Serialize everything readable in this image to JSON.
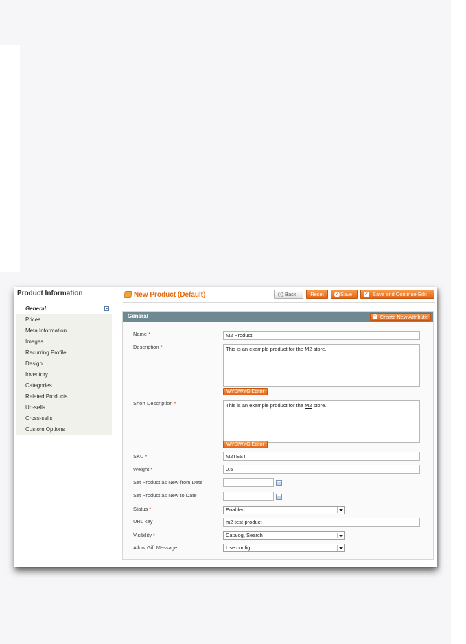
{
  "sidebar": {
    "title": "Product Information",
    "tabs": [
      {
        "label": "General"
      },
      {
        "label": "Prices"
      },
      {
        "label": "Meta Information"
      },
      {
        "label": "Images"
      },
      {
        "label": "Recurring Profile"
      },
      {
        "label": "Design"
      },
      {
        "label": "Inventory"
      },
      {
        "label": "Categories"
      },
      {
        "label": "Related Products"
      },
      {
        "label": "Up-sells"
      },
      {
        "label": "Cross-sells"
      },
      {
        "label": "Custom Options"
      }
    ]
  },
  "header": {
    "title": "New Product (Default)",
    "buttons": {
      "back": "Back",
      "reset": "Reset",
      "save": "Save",
      "save_continue": "Save and Continue Edit"
    }
  },
  "section": {
    "title": "General",
    "create_attribute": "Create New Attribute",
    "required_mark": "*",
    "wysiwyg_label": "WYSIWYG Editor",
    "fields": {
      "name": {
        "label": "Name",
        "value": "M2 Product"
      },
      "description": {
        "label": "Description",
        "value_pre": "This is an example product for the ",
        "value_link": "M2",
        "value_post": " store."
      },
      "short_description": {
        "label": "Short Description",
        "value_pre": "This is an example product for the ",
        "value_link": "M2",
        "value_post": " store."
      },
      "sku": {
        "label": "SKU",
        "value": "M2TEST"
      },
      "weight": {
        "label": "Weight",
        "value": "0.5"
      },
      "new_from": {
        "label": "Set Product as New from Date",
        "value": ""
      },
      "new_to": {
        "label": "Set Product as New to Date",
        "value": ""
      },
      "status": {
        "label": "Status",
        "value": "Enabled"
      },
      "url_key": {
        "label": "URL key",
        "value": "m2-test-product"
      },
      "visibility": {
        "label": "Visibility",
        "value": "Catalog, Search"
      },
      "gift_message": {
        "label": "Allow Gift Message",
        "value": "Use config"
      }
    }
  },
  "colors": {
    "accent": "#e36c11",
    "section_header": "#6f8992",
    "required": "#eb340a"
  }
}
